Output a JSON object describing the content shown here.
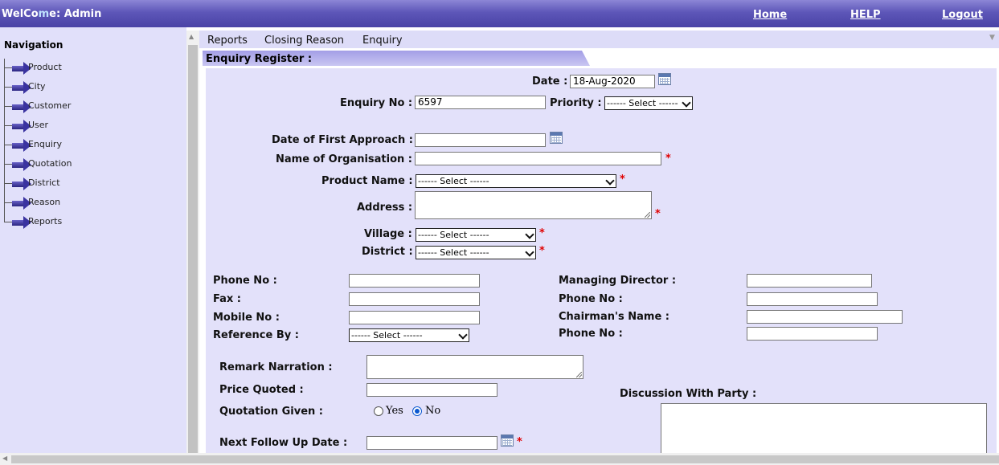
{
  "header": {
    "welcome_pre": "WelCo",
    "welcome_hl": "m",
    "welcome_post": "e: Admin",
    "links": {
      "home": "Home",
      "help": "HELP",
      "logout": "Logout"
    }
  },
  "sidebar": {
    "title": "Navigation",
    "items": [
      "Product",
      "City",
      "Customer",
      "User",
      "Enquiry",
      "Quotation",
      "District",
      "Reason",
      "Reports"
    ]
  },
  "menu": {
    "items": [
      "Reports",
      "Closing Reason",
      "Enquiry"
    ]
  },
  "section": {
    "title": "Enquiry Register :"
  },
  "form": {
    "date_label": "Date :",
    "date_value": "18-Aug-2020",
    "enquiry_no_label": "Enquiry No :",
    "enquiry_no_value": "6597",
    "priority_label": "Priority :",
    "priority_value": "------ Select ------",
    "first_approach_label": "Date of First Approach :",
    "organisation_label": "Name of Organisation :",
    "product_label": "Product Name :",
    "product_value": "------ Select ------",
    "address_label": "Address :",
    "village_label": "Village :",
    "village_value": "------ Select ------",
    "district_label": "District :",
    "district_value": "------ Select ------",
    "phone_label": "Phone No :",
    "fax_label": "Fax :",
    "mobile_label": "Mobile No :",
    "reference_label": "Reference By :",
    "reference_value": "------ Select ------",
    "md_label": "Managing Director :",
    "md_phone_label": "Phone No :",
    "chairman_label": "Chairman's Name :",
    "chairman_phone_label": "Phone No :",
    "remark_label": "Remark Narration :",
    "price_label": "Price Quoted :",
    "quotation_label": "Quotation Given :",
    "quotation_yes": "Yes",
    "quotation_no": "No",
    "followup_label": "Next Follow Up Date :",
    "discussion_label": "Discussion With Party :",
    "required_mark": "*"
  },
  "colors": {
    "header": "#4a43a6",
    "sidebar": "#e1e0fa",
    "form_bg": "#e3e1fa",
    "required": "#e00000"
  }
}
